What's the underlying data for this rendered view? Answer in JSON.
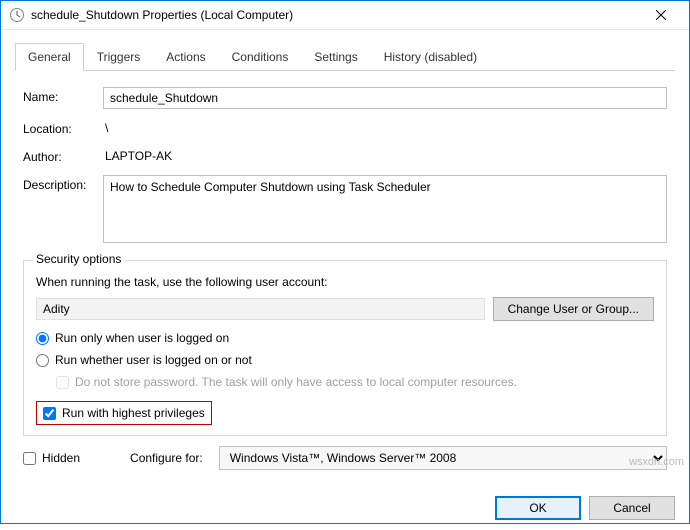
{
  "window": {
    "title": "schedule_Shutdown Properties (Local Computer)"
  },
  "tabs": {
    "general": "General",
    "triggers": "Triggers",
    "actions": "Actions",
    "conditions": "Conditions",
    "settings": "Settings",
    "history": "History (disabled)"
  },
  "labels": {
    "name": "Name:",
    "location": "Location:",
    "author": "Author:",
    "description": "Description:",
    "security_options": "Security options",
    "when_running": "When running the task, use the following user account:",
    "change_user": "Change User or Group...",
    "run_logged_on": "Run only when user is logged on",
    "run_whether": "Run whether user is logged on or not",
    "do_not_store": "Do not store password.  The task will only have access to local computer resources.",
    "highest_priv": "Run with highest privileges",
    "hidden": "Hidden",
    "configure_for": "Configure for:",
    "ok": "OK",
    "cancel": "Cancel"
  },
  "values": {
    "name": "schedule_Shutdown",
    "location": "\\",
    "author": "LAPTOP-AK",
    "description": "How to Schedule Computer Shutdown using Task Scheduler",
    "user_account": "Adity",
    "configure_for": "Windows Vista™, Windows Server™ 2008"
  },
  "state": {
    "active_tab": "general",
    "run_mode": "logged_on",
    "do_not_store_password": false,
    "highest_privileges": true,
    "hidden": false
  },
  "watermark": "wsxdn.com"
}
